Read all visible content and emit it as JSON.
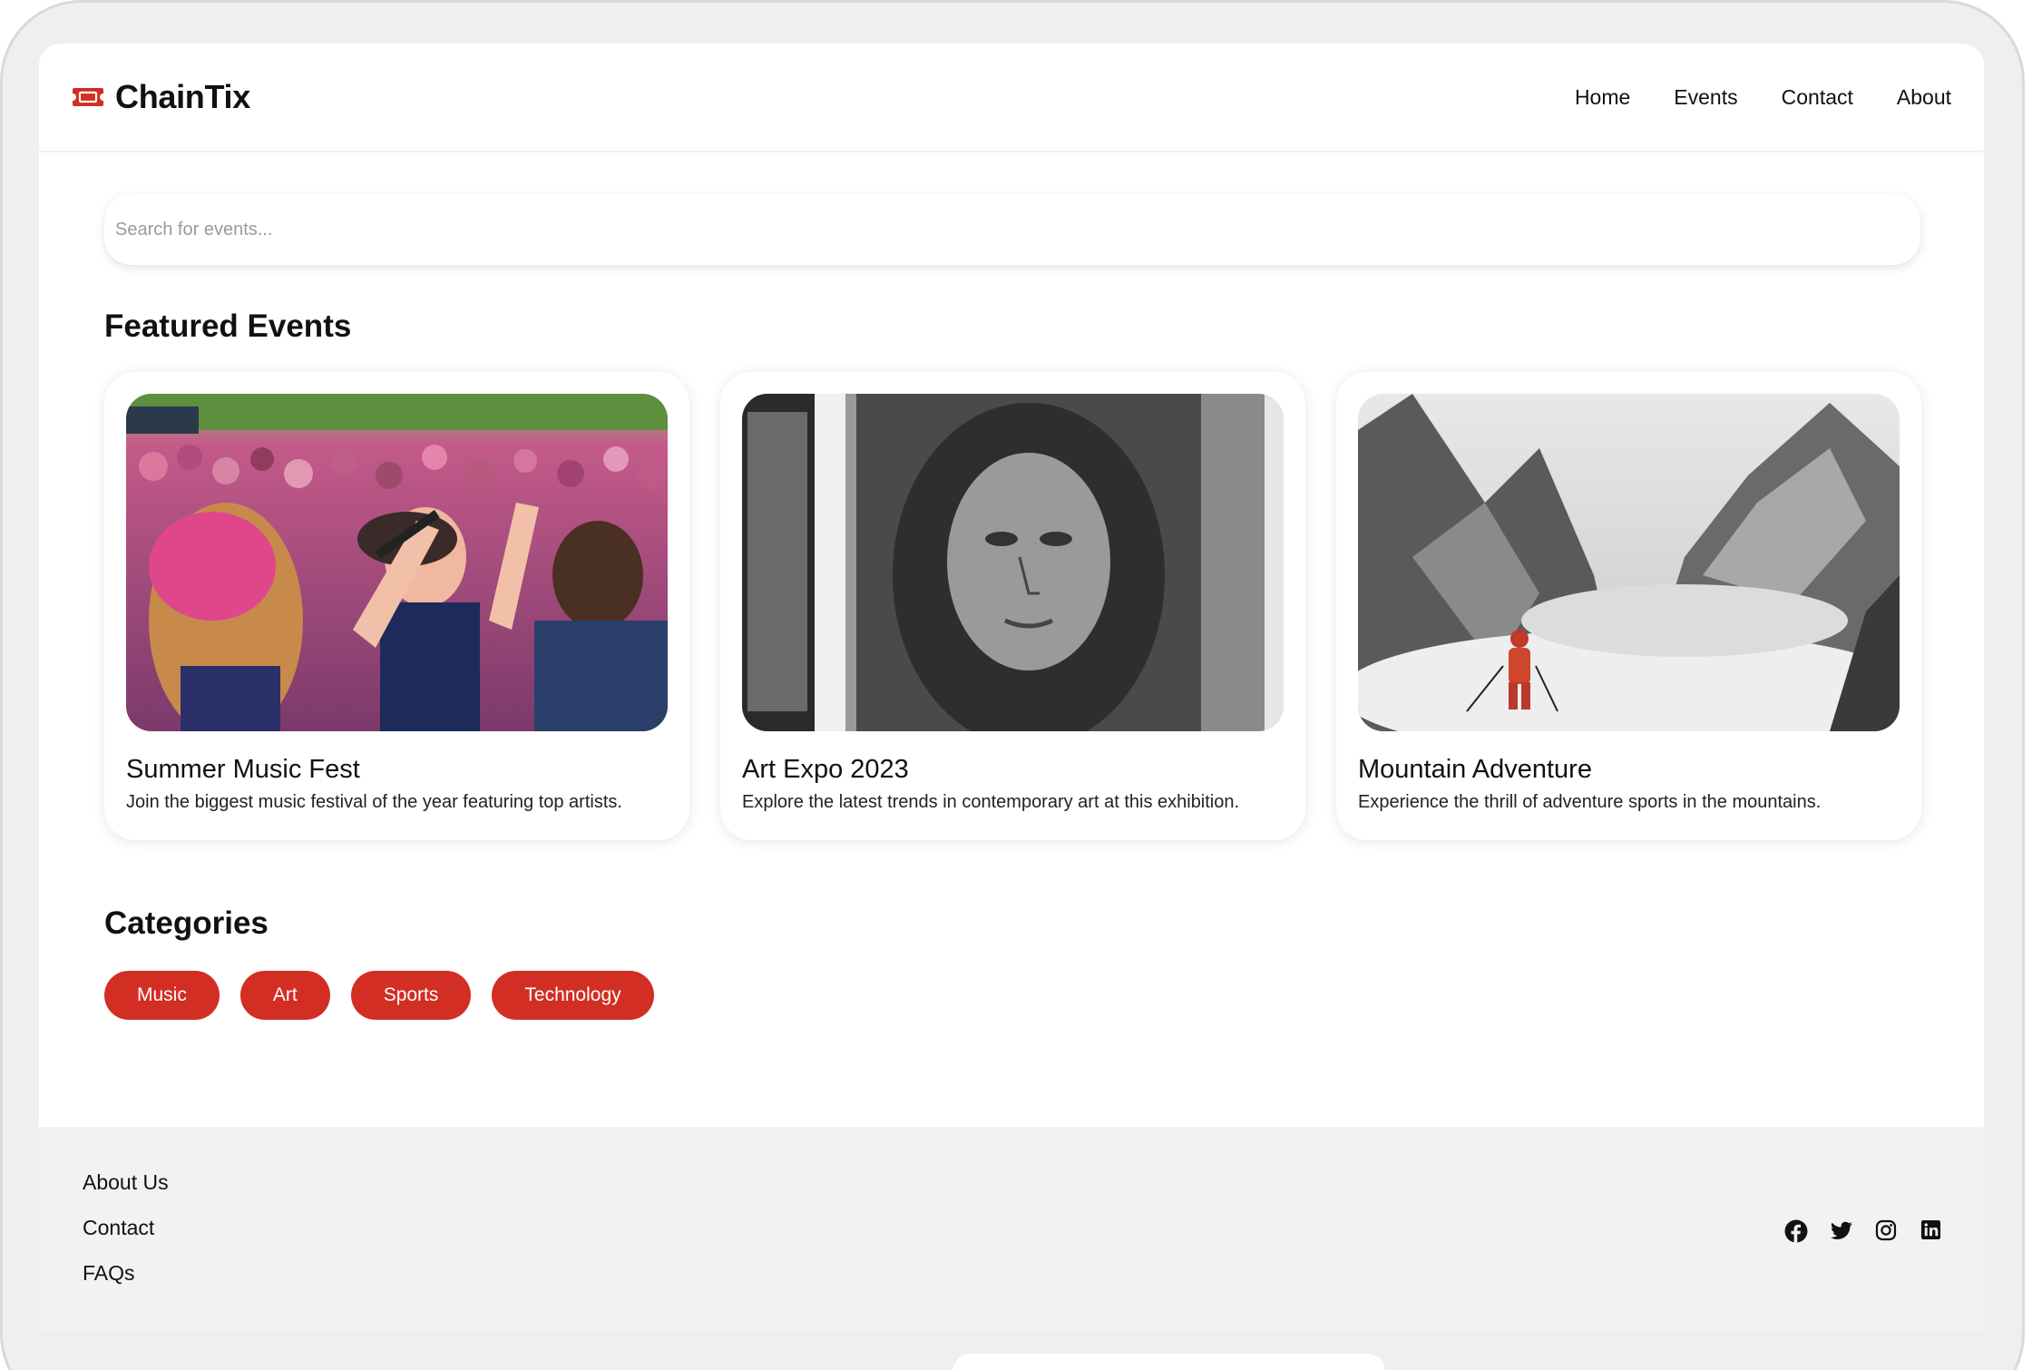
{
  "brand": {
    "name": "ChainTix",
    "icon": "ticket-icon",
    "accent": "#d22e24"
  },
  "nav": {
    "items": [
      "Home",
      "Events",
      "Contact",
      "About"
    ]
  },
  "search": {
    "placeholder": "Search for events...",
    "value": ""
  },
  "featured": {
    "title": "Featured Events",
    "events": [
      {
        "title": "Summer Music Fest",
        "description": "Join the biggest music festival of the year featuring top artists.",
        "image": "concert-crowd-photo"
      },
      {
        "title": "Art Expo 2023",
        "description": "Explore the latest trends in contemporary art at this exhibition.",
        "image": "portrait-artwork-photo"
      },
      {
        "title": "Mountain Adventure",
        "description": "Experience the thrill of adventure sports in the mountains.",
        "image": "mountain-skier-photo"
      }
    ]
  },
  "categories": {
    "title": "Categories",
    "items": [
      "Music",
      "Art",
      "Sports",
      "Technology"
    ]
  },
  "footer": {
    "links": [
      "About Us",
      "Contact",
      "FAQs"
    ],
    "socials": [
      "facebook-icon",
      "twitter-icon",
      "instagram-icon",
      "linkedin-icon"
    ]
  }
}
